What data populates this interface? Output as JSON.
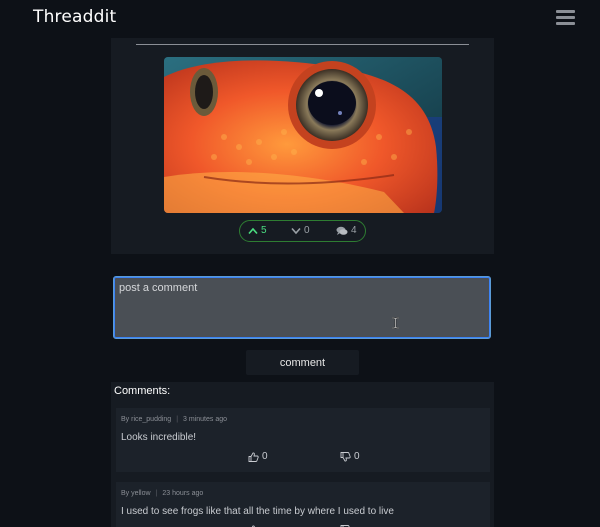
{
  "navbar": {
    "brand": "Threaddit",
    "menu_icon": "hamburger-icon"
  },
  "post": {
    "image_alt_icon": "frog-image",
    "votes": {
      "upvotes": "5",
      "downvotes": "0",
      "comments": "4",
      "upvote_icon": "chevron-up-icon",
      "downvote_icon": "chevron-down-icon",
      "comment_icon": "comments-icon"
    }
  },
  "comment_form": {
    "placeholder": "post a comment",
    "submit_label": "comment"
  },
  "comments": {
    "header": "Comments:",
    "items": [
      {
        "author": "By rice_pudding",
        "time": "3 minutes ago",
        "text": "Looks incredible!",
        "likes": "0",
        "dislikes": "0"
      },
      {
        "author": "By yellow",
        "time": "23 hours ago",
        "text": "I used to see frogs like that all the time by where I used to live",
        "likes": "",
        "dislikes": ""
      }
    ]
  },
  "colors": {
    "background": "#0d1117",
    "card": "#161b22",
    "accent_green": "#4ade80",
    "input_border": "#5b9bd5"
  }
}
